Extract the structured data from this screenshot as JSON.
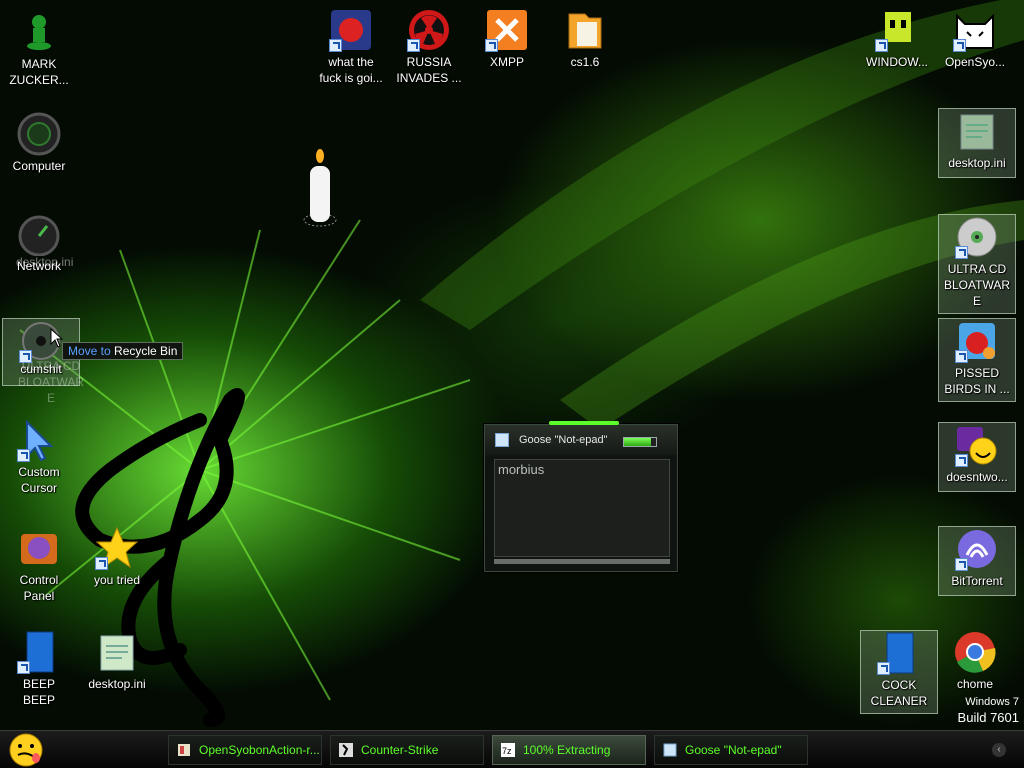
{
  "desktop_icons": {
    "mark": "MARK\nZUCKER...",
    "computer": "Computer",
    "network": "Network",
    "network_ghost": "desktop.ini",
    "cumshit": "cumshit",
    "cumshit_ghost": "ULTRA CD\nBLOATWAR\nE",
    "custom_cursor": "Custom\nCursor",
    "control_panel": "Control\nPanel",
    "you_tried": "you tried",
    "beep": "BEEP\nBEEP",
    "desktop_ini_left": "desktop.ini",
    "what_the": "what the\nfuck is goi...",
    "russia": "RUSSIA\nINVADES ...",
    "xmpp": "XMPP",
    "cs16": "cs1.6",
    "window": "WINDOW...",
    "opensyo": "OpenSyo...",
    "desktop_ini_right": "desktop.ini",
    "ultra_cd": "ULTRA CD\nBLOATWAR\nE",
    "pissed_birds": "PISSED\nBIRDS IN ...",
    "doesntwo": "doesntwo...",
    "bittorrent": "BitTorrent",
    "cock_cleaner": "COCK\nCLEANER",
    "chome": "chome"
  },
  "drag_tooltip": {
    "action": "Move to",
    "target": "Recycle Bin"
  },
  "note_window": {
    "title": "Goose \"Not-epad\"",
    "text": "morbius",
    "meter_fraction": 0.85
  },
  "taskbar": {
    "items": [
      {
        "label": "OpenSyobonAction-r..."
      },
      {
        "label": "Counter-Strike"
      },
      {
        "label": "100% Extracting"
      },
      {
        "label": "Goose \"Not-epad\""
      }
    ]
  },
  "watermark": {
    "line1": "Windows 7",
    "line2": "Build 7601"
  },
  "colors": {
    "accent": "#5cff2a",
    "taskbar_text": "#5cff2a",
    "tooltip_action": "#5aa0ff"
  }
}
